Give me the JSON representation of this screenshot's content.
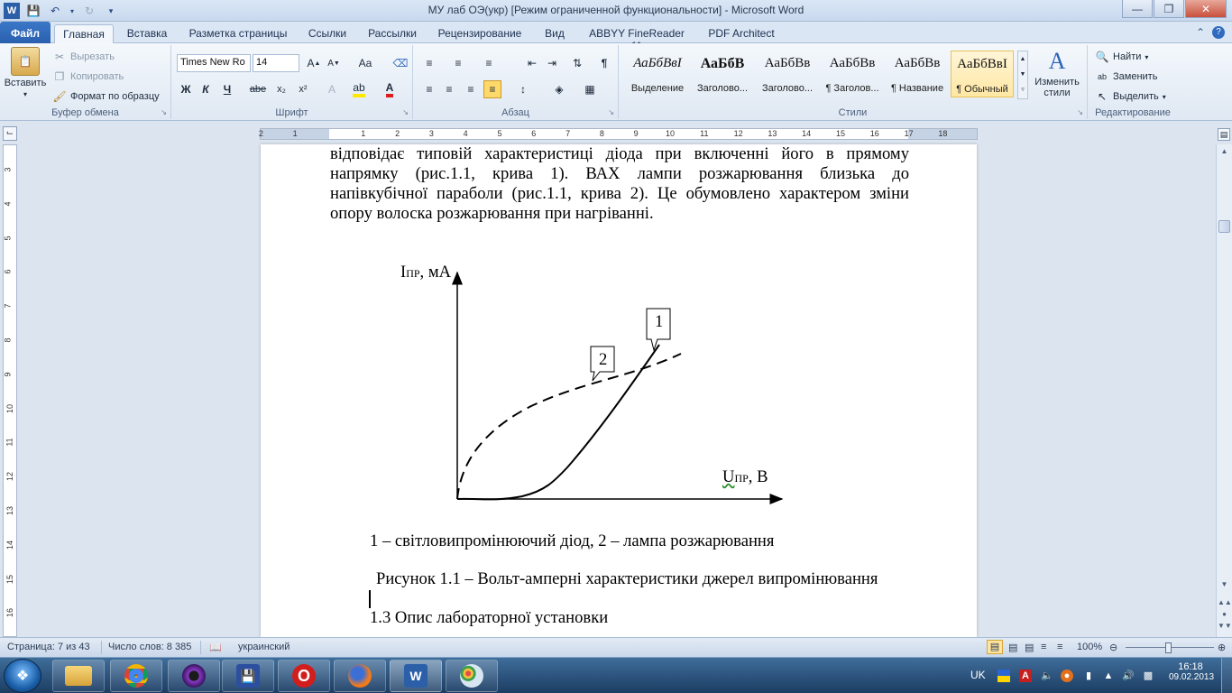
{
  "window": {
    "title": "МУ лаб ОЭ(укр) [Режим ограниченной функциональности]  -  Microsoft Word"
  },
  "tabs": [
    "Файл",
    "Главная",
    "Вставка",
    "Разметка страницы",
    "Ссылки",
    "Рассылки",
    "Рецензирование",
    "Вид",
    "ABBYY FineReader 11",
    "PDF Architect"
  ],
  "clipboard": {
    "paste": "Вставить",
    "cut": "Вырезать",
    "copy": "Копировать",
    "format_painter": "Формат по образцу",
    "label": "Буфер обмена"
  },
  "font": {
    "name": "Times New Ro",
    "size": "14",
    "label": "Шрифт",
    "bold": "Ж",
    "italic": "К",
    "underline": "Ч",
    "strike": "abe",
    "subscript": "x₂",
    "superscript": "x²",
    "case": "Aa"
  },
  "paragraph": {
    "label": "Абзац"
  },
  "styles": {
    "label": "Стили",
    "items": [
      {
        "sample": "АаБбВвІ",
        "name": "Выделение"
      },
      {
        "sample": "АаБбВ",
        "name": "Заголово..."
      },
      {
        "sample": "АаБбВв",
        "name": "Заголово..."
      },
      {
        "sample": "АаБбВв",
        "name": "¶ Заголов..."
      },
      {
        "sample": "АаБбВв",
        "name": "¶ Название"
      },
      {
        "sample": "АаБбВвІ",
        "name": "¶ Обычный"
      }
    ],
    "change": "Изменить стили"
  },
  "editing": {
    "label": "Редактирование",
    "find": "Найти",
    "replace": "Заменить",
    "select": "Выделить"
  },
  "ruler": {
    "numbers": [
      "2",
      "1",
      "1",
      "2",
      "3",
      "4",
      "5",
      "6",
      "7",
      "8",
      "9",
      "10",
      "11",
      "12",
      "13",
      "14",
      "15",
      "16",
      "17",
      "18"
    ]
  },
  "vruler": {
    "numbers": [
      "3",
      "4",
      "5",
      "6",
      "7",
      "8",
      "9",
      "10",
      "11",
      "12",
      "13",
      "14",
      "15",
      "16"
    ]
  },
  "document": {
    "paragraph_lines": [
      "відповідає типовій характеристиці діода при включенні його в прямому",
      "напрямку (рис.1.1, крива 1). ВАХ лампи розжарювання близька до",
      "напівкубічної параболи (рис.1.1, крива 2). Це обумовлено характером зміни",
      "опору волоска розжарювання при нагріванні."
    ],
    "figure": {
      "y_axis_main": "I",
      "y_axis_sub": "ПР",
      "y_axis_unit": ", мА",
      "x_axis_main": "U",
      "x_axis_sub": "ПР",
      "x_axis_unit": ", В",
      "callout_1": "1",
      "callout_2": "2"
    },
    "legend": "1 – світловипромінюючий діод, 2 – лампа розжарювання",
    "caption": "Рисунок 1.1 – Вольт-амперні характеристики джерел випромінювання",
    "heading": "1.3 Опис лабораторної установки"
  },
  "status": {
    "page": "Страница: 7 из 43",
    "words": "Число слов: 8 385",
    "language": "украинский",
    "zoom": "100%"
  },
  "taskbar": {
    "lang": "UK",
    "time": "16:18",
    "date": "09.02.2013"
  },
  "colors": {
    "file_tab": "#2a5fae",
    "selected_style": "#ffe7a3",
    "taskbar": "#1c3d63"
  }
}
